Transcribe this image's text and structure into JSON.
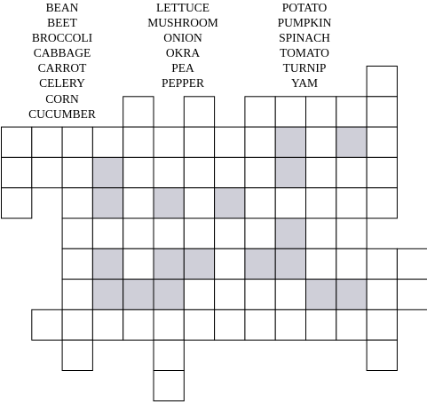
{
  "puzzle": {
    "word_columns": [
      [
        "BEAN",
        "BEET",
        "BROCCOLI",
        "CABBAGE",
        "CARROT",
        "CELERY",
        "CORN",
        "CUCUMBER"
      ],
      [
        "LETTUCE",
        "MUSHROOM",
        "ONION",
        "OKRA",
        "PEA",
        "PEPPER"
      ],
      [
        "POTATO",
        "PUMPKIN",
        "SPINACH",
        "TOMATO",
        "TURNIP",
        "YAM"
      ]
    ],
    "colors": {
      "cell_fill": "#ffffff",
      "shaded_fill": "#cfcfd8",
      "border": "#000000"
    },
    "grid_rows": [
      [
        null,
        null,
        null,
        null,
        null,
        null,
        null,
        null,
        null,
        null,
        null,
        null,
        "W",
        null
      ],
      [
        null,
        null,
        null,
        null,
        "W",
        null,
        "W",
        null,
        "W",
        "W",
        "W",
        "W",
        "W",
        null
      ],
      [
        "W",
        "W",
        "W",
        "W",
        "W",
        "W",
        "W",
        "W",
        "W",
        "S",
        "W",
        "S",
        "W",
        null
      ],
      [
        "W",
        "W",
        "W",
        "S",
        "W",
        "W",
        "W",
        "W",
        "W",
        "S",
        "W",
        "W",
        "W",
        null
      ],
      [
        "W",
        null,
        "W",
        "S",
        "W",
        "S",
        "W",
        "S",
        "W",
        "W",
        "W",
        "W",
        "W",
        null
      ],
      [
        null,
        null,
        "W",
        "W",
        "W",
        "W",
        "W",
        "W",
        "W",
        "S",
        "W",
        "W",
        null,
        null
      ],
      [
        null,
        null,
        "W",
        "S",
        "W",
        "S",
        "S",
        "W",
        "S",
        "S",
        "W",
        "W",
        "W",
        "W"
      ],
      [
        null,
        null,
        "W",
        "S",
        "S",
        "S",
        "W",
        "W",
        "W",
        "W",
        "S",
        "S",
        "W",
        "W"
      ],
      [
        null,
        "W",
        "W",
        "W",
        "W",
        "W",
        "W",
        "W",
        "W",
        "W",
        "W",
        "W",
        "W",
        null
      ],
      [
        null,
        null,
        "W",
        null,
        null,
        "W",
        null,
        null,
        null,
        null,
        null,
        null,
        "W",
        null
      ],
      [
        null,
        null,
        null,
        null,
        null,
        "W",
        null,
        null,
        null,
        null,
        null,
        null,
        null,
        null
      ]
    ]
  }
}
